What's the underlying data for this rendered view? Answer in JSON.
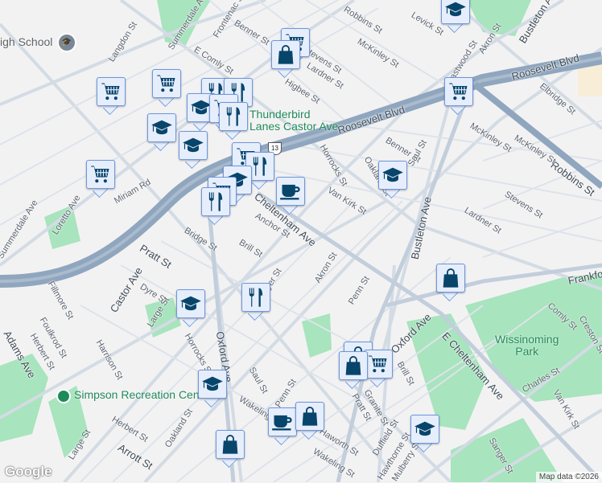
{
  "map": {
    "attribution": "Map data ©2026",
    "logo": "Google",
    "route_shield": "13",
    "pois": {
      "high_school": "igh School",
      "thunderbird": [
        "Thunderbird",
        "Lanes Castor Ave"
      ],
      "wissinoming": [
        "Wissinoming",
        "Park"
      ],
      "simpson": "Simpson Recreation Center"
    },
    "streets": [
      "Langdon St",
      "Summerdale Ave",
      "Frontenac St",
      "Benner St",
      "E Comly St",
      "Van Kirk St",
      "Loretto Ave",
      "Miriam Rd",
      "Summerdale Ave",
      "Loretto Ave",
      "Pratt St",
      "Bridge St",
      "Brill St",
      "Anchor St",
      "Castor Ave",
      "Oxford Ave",
      "Dyre St",
      "Fillmore St",
      "Foulkrod St",
      "Harrison St",
      "Large St",
      "Horrocks St",
      "Herbert St",
      "Adams Ave",
      "Herbert St",
      "Oakland St",
      "Arrott St",
      "Large St",
      "Saul St",
      "Wakeling St",
      "Penn St",
      "Haworth St",
      "Wakeling St",
      "Pratt St",
      "Granite St",
      "Duffield St",
      "Hawthorne St",
      "Mulberry St",
      "Sanger St",
      "Charles St",
      "Van Kirk St",
      "Creston St",
      "Comly St",
      "Frankford Ave",
      "Oxford Ave",
      "Brill St",
      "E Cheltenham Ave",
      "Penn St",
      "Akron St",
      "Bustleton Ave",
      "Stevens St",
      "Lardner St",
      "Robbins St",
      "McKinley St",
      "Elbridge St",
      "Roosevelt Blvd",
      "McKinley St",
      "Eastwood St",
      "Akron St",
      "Levick St",
      "Robbins St",
      "Bustleton Ave",
      "Benner St",
      "Horrocks St",
      "Oakland St",
      "Saul St",
      "Van Kirk St",
      "Higbee St",
      "Stevens St",
      "Lardner St",
      "Robbins St",
      "McKinley St",
      "Castor Ave",
      "Roosevelt Blvd",
      "Cheltenham Ave",
      "Dyer St",
      "Oxford Ave",
      "E Cheltenham Ave"
    ],
    "markers": [
      {
        "type": "cart"
      },
      {
        "type": "bag"
      },
      {
        "type": "school"
      },
      {
        "type": "cart"
      },
      {
        "type": "cart"
      },
      {
        "type": "school"
      },
      {
        "type": "cart"
      },
      {
        "type": "school"
      },
      {
        "type": "restaurant"
      },
      {
        "type": "restaurant"
      },
      {
        "type": "school"
      },
      {
        "type": "cart"
      },
      {
        "type": "restaurant"
      },
      {
        "type": "cart"
      },
      {
        "type": "restaurant"
      },
      {
        "type": "school"
      },
      {
        "type": "cart"
      },
      {
        "type": "restaurant"
      },
      {
        "type": "cafe"
      },
      {
        "type": "cart"
      },
      {
        "type": "school"
      },
      {
        "type": "bag"
      },
      {
        "type": "restaurant"
      },
      {
        "type": "school"
      },
      {
        "type": "school"
      },
      {
        "type": "bag"
      },
      {
        "type": "cafe"
      },
      {
        "type": "bag"
      },
      {
        "type": "bag"
      },
      {
        "type": "cart"
      },
      {
        "type": "bag"
      },
      {
        "type": "school"
      }
    ],
    "colors": {
      "background": "#f3f2f3",
      "road": "#cfd8e2",
      "highway": "#8fa6be",
      "park": "#a8e4bd",
      "marker_icon": "#08456b",
      "marker_bg": "#e6eefc"
    }
  }
}
